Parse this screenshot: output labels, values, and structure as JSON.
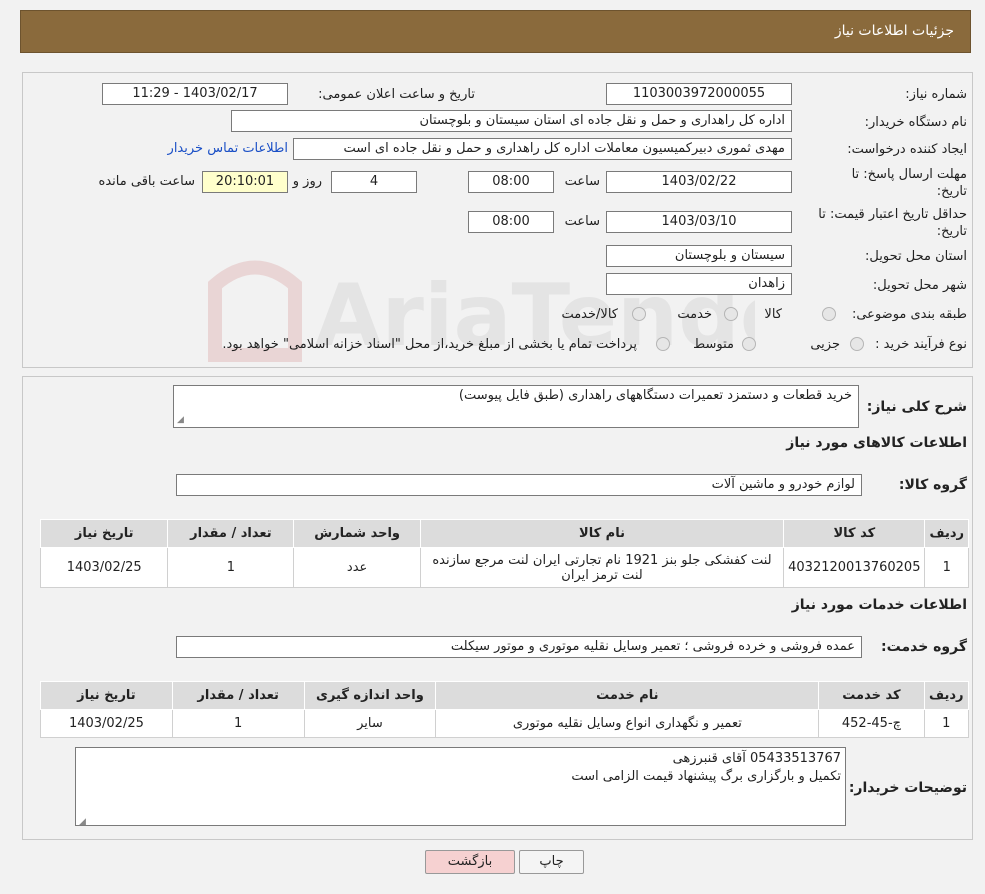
{
  "header": {
    "title": "جزئیات اطلاعات نیاز"
  },
  "watermark": {
    "text": "AriaTender.neT"
  },
  "details": {
    "need_number_label": "شماره نیاز:",
    "need_number": "1103003972000055",
    "announce_label": "تاریخ و ساعت اعلان عمومی:",
    "announce_value": "1403/02/17 - 11:29",
    "buyer_label": "نام دستگاه خریدار:",
    "buyer_value": "اداره کل راهداری و حمل و نقل جاده ای استان سیستان و بلوچستان",
    "creator_label": "ایجاد کننده درخواست:",
    "creator_value": "مهدی ثموری دبیرکمیسیون معاملات اداره کل راهداری و حمل و نقل جاده ای است",
    "contact_link": "اطلاعات تماس خریدار",
    "deadline_label_1": "مهلت ارسال پاسخ: تا",
    "deadline_label_2": "تاریخ:",
    "deadline_date": "1403/02/22",
    "time_label": "ساعت",
    "deadline_time": "08:00",
    "days_value": "4",
    "days_label": "روز و",
    "remaining_time": "20:10:01",
    "remaining_label": "ساعت باقی مانده",
    "validity_label_1": "حداقل تاریخ اعتبار قیمت: تا",
    "validity_label_2": "تاریخ:",
    "validity_date": "1403/03/10",
    "validity_time": "08:00",
    "province_label": "استان محل تحویل:",
    "province_value": "سیستان و بلوچستان",
    "city_label": "شهر محل تحویل:",
    "city_value": "زاهدان",
    "category_label": "طبقه بندی موضوعی:",
    "category_options": [
      "کالا",
      "خدمت",
      "کالا/خدمت"
    ],
    "process_label": "نوع فرآیند خرید :",
    "process_options": [
      "جزیی",
      "متوسط"
    ],
    "process_note": "پرداخت تمام یا بخشی از مبلغ خرید،از محل \"اسناد خزانه اسلامی\" خواهد بود."
  },
  "summary": {
    "desc_label": "شرح کلی نیاز:",
    "desc_value": "خرید قطعات و دستمزد تعمیرات دستگاههای راهداری (طبق فایل پیوست)",
    "goods_title": "اطلاعات کالاهای مورد نیاز",
    "goods_group_label": "گروه کالا:",
    "goods_group_value": "لوازم خودرو و ماشین آلات",
    "goods_headers": [
      "ردیف",
      "کد کالا",
      "نام کالا",
      "واحد شمارش",
      "تعداد / مقدار",
      "تاریخ نیاز"
    ],
    "goods_rows": [
      [
        "1",
        "4032120013760205",
        "لنت کفشکی جلو بنز 1921 نام تجارتی ایران لنت مرجع سازنده لنت ترمز ایران",
        "عدد",
        "1",
        "1403/02/25"
      ]
    ],
    "services_title": "اطلاعات خدمات مورد نیاز",
    "service_group_label": "گروه خدمت:",
    "service_group_value": "عمده فروشی و خرده فروشی ؛ تعمیر وسایل نقلیه موتوری و موتور سیکلت",
    "service_headers": [
      "ردیف",
      "کد خدمت",
      "نام خدمت",
      "واحد اندازه گیری",
      "تعداد / مقدار",
      "تاریخ نیاز"
    ],
    "service_rows": [
      [
        "1",
        "چ-45-452",
        "تعمیر و نگهداری انواع وسایل نقلیه موتوری",
        "سایر",
        "1",
        "1403/02/25"
      ]
    ],
    "buyer_notes_label": "توضیحات خریدار:",
    "buyer_notes_line1": "05433513767 آقای قنبرزهی",
    "buyer_notes_line2": "تکمیل و بارگزاری برگ پیشنهاد قیمت الزامی است"
  },
  "buttons": {
    "print": "چاپ",
    "back": "بازگشت"
  }
}
